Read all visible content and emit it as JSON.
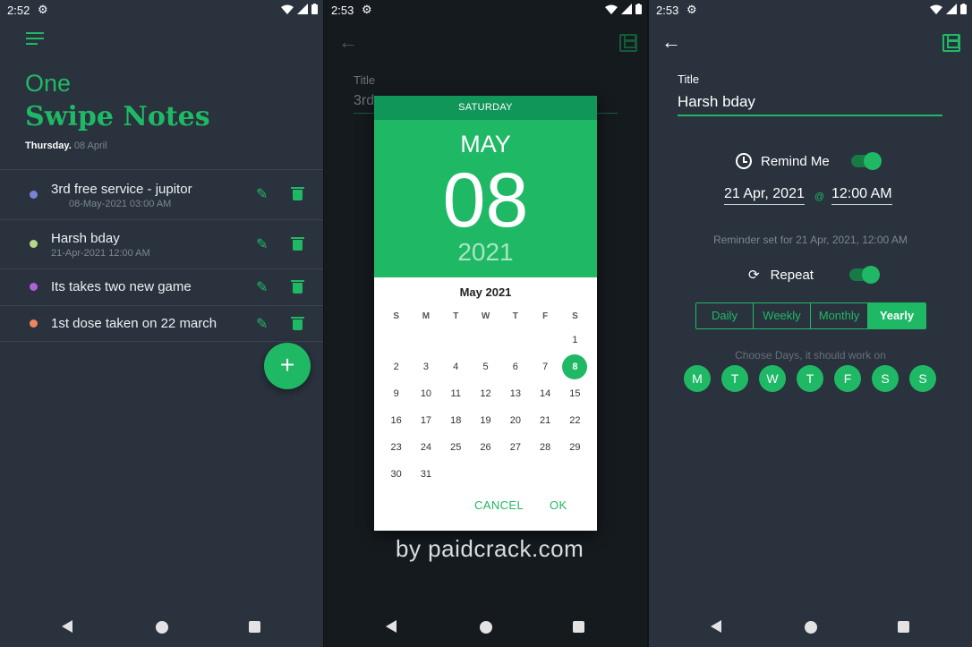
{
  "panel1": {
    "status": {
      "time": "2:52"
    },
    "app_one": "One",
    "app_title": "Swipe Notes",
    "day_label": "Thursday.",
    "date_label": "08 April",
    "notes": [
      {
        "title": "3rd free service - jupitor",
        "date": "08-May-2021 03:00 AM",
        "color": "#7b83d8"
      },
      {
        "title": "Harsh bday",
        "date": "21-Apr-2021 12:00 AM",
        "color": "#b6d88a"
      },
      {
        "title": "Its takes two new game",
        "date": "",
        "color": "#b061d3"
      },
      {
        "title": "1st dose taken on 22 march",
        "date": "",
        "color": "#f0855e"
      }
    ],
    "fab_label": "+"
  },
  "panel2": {
    "status": {
      "time": "2:53"
    },
    "bg_title_label": "Title",
    "bg_title_value": "3rd",
    "dialog": {
      "day_of_week": "SATURDAY",
      "month": "MAY",
      "day": "08",
      "year": "2021",
      "calendar_title": "May 2021",
      "weekdays": [
        "S",
        "M",
        "T",
        "W",
        "T",
        "F",
        "S"
      ],
      "leading_blanks": 6,
      "days_in_month": 31,
      "selected_day": 8,
      "cancel_label": "CANCEL",
      "ok_label": "OK"
    },
    "watermark": "by paidcrack.com"
  },
  "panel3": {
    "status": {
      "time": "2:53"
    },
    "title_label": "Title",
    "title_value": "Harsh bday",
    "remind_me_label": "Remind Me",
    "remind_me_on": true,
    "date_value": "21 Apr, 2021",
    "at_symbol": "@",
    "time_value": "12:00 AM",
    "reminder_note": "Reminder set for 21 Apr, 2021, 12:00 AM",
    "repeat_label": "Repeat",
    "repeat_on": true,
    "repeat_options": [
      "Daily",
      "Weekly",
      "Monthly",
      "Yearly"
    ],
    "repeat_selected": "Yearly",
    "days_caption": "Choose Days, it should work on",
    "days": [
      "M",
      "T",
      "W",
      "T",
      "F",
      "S",
      "S"
    ]
  },
  "colors": {
    "accent": "#1fb965",
    "background": "#29323d",
    "dialog_header": "#1fb965",
    "dialog_dow_bar": "#11965a"
  }
}
